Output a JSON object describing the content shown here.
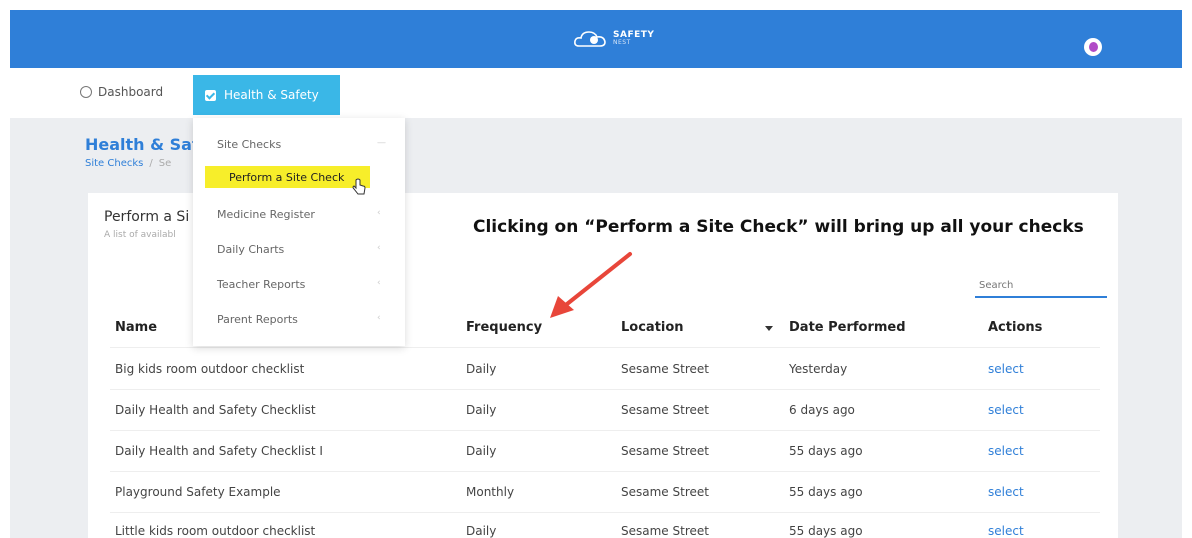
{
  "header": {
    "logo_line1": "SAFETY",
    "logo_line2": "NEST",
    "avatar_color": "#b04bc6",
    "brand_color": "#2f7fd8"
  },
  "nav": {
    "dashboard": "Dashboard",
    "health_safety": "Health & Safety",
    "active_color": "#3ab7e7"
  },
  "page": {
    "title": "Health & Saf",
    "breadcrumb_current": "Site Checks",
    "breadcrumb_next": "Se"
  },
  "card": {
    "title": "Perform a Si",
    "subtitle": "A list of availabl"
  },
  "annotation": "Clicking on “Perform a Site Check” will bring up all your checks",
  "search": {
    "placeholder": "Search"
  },
  "dropdown": {
    "items": [
      {
        "label": "Site Checks",
        "chevron": "—"
      },
      {
        "label": "Perform a Site Check",
        "highlight": "#f7ee2a"
      },
      {
        "label": "Medicine Register",
        "chevron": "‹"
      },
      {
        "label": "Daily Charts",
        "chevron": "‹"
      },
      {
        "label": "Teacher Reports",
        "chevron": "‹"
      },
      {
        "label": "Parent Reports",
        "chevron": "‹"
      }
    ]
  },
  "table": {
    "headers": [
      "Name",
      "Frequency",
      "Location",
      "Date Performed",
      "Actions"
    ],
    "rows": [
      [
        "Big kids room outdoor checklist",
        "Daily",
        "Sesame Street",
        "Yesterday",
        "select"
      ],
      [
        "Daily Health and Safety Checklist",
        "Daily",
        "Sesame Street",
        "6 days ago",
        "select"
      ],
      [
        "Daily Health and Safety Checklist I",
        "Daily",
        "Sesame Street",
        "55 days ago",
        "select"
      ],
      [
        "Playground Safety Example",
        "Monthly",
        "Sesame Street",
        "55 days ago",
        "select"
      ],
      [
        "Little kids room outdoor checklist",
        "Daily",
        "Sesame Street",
        "55 days ago",
        "select"
      ]
    ]
  }
}
